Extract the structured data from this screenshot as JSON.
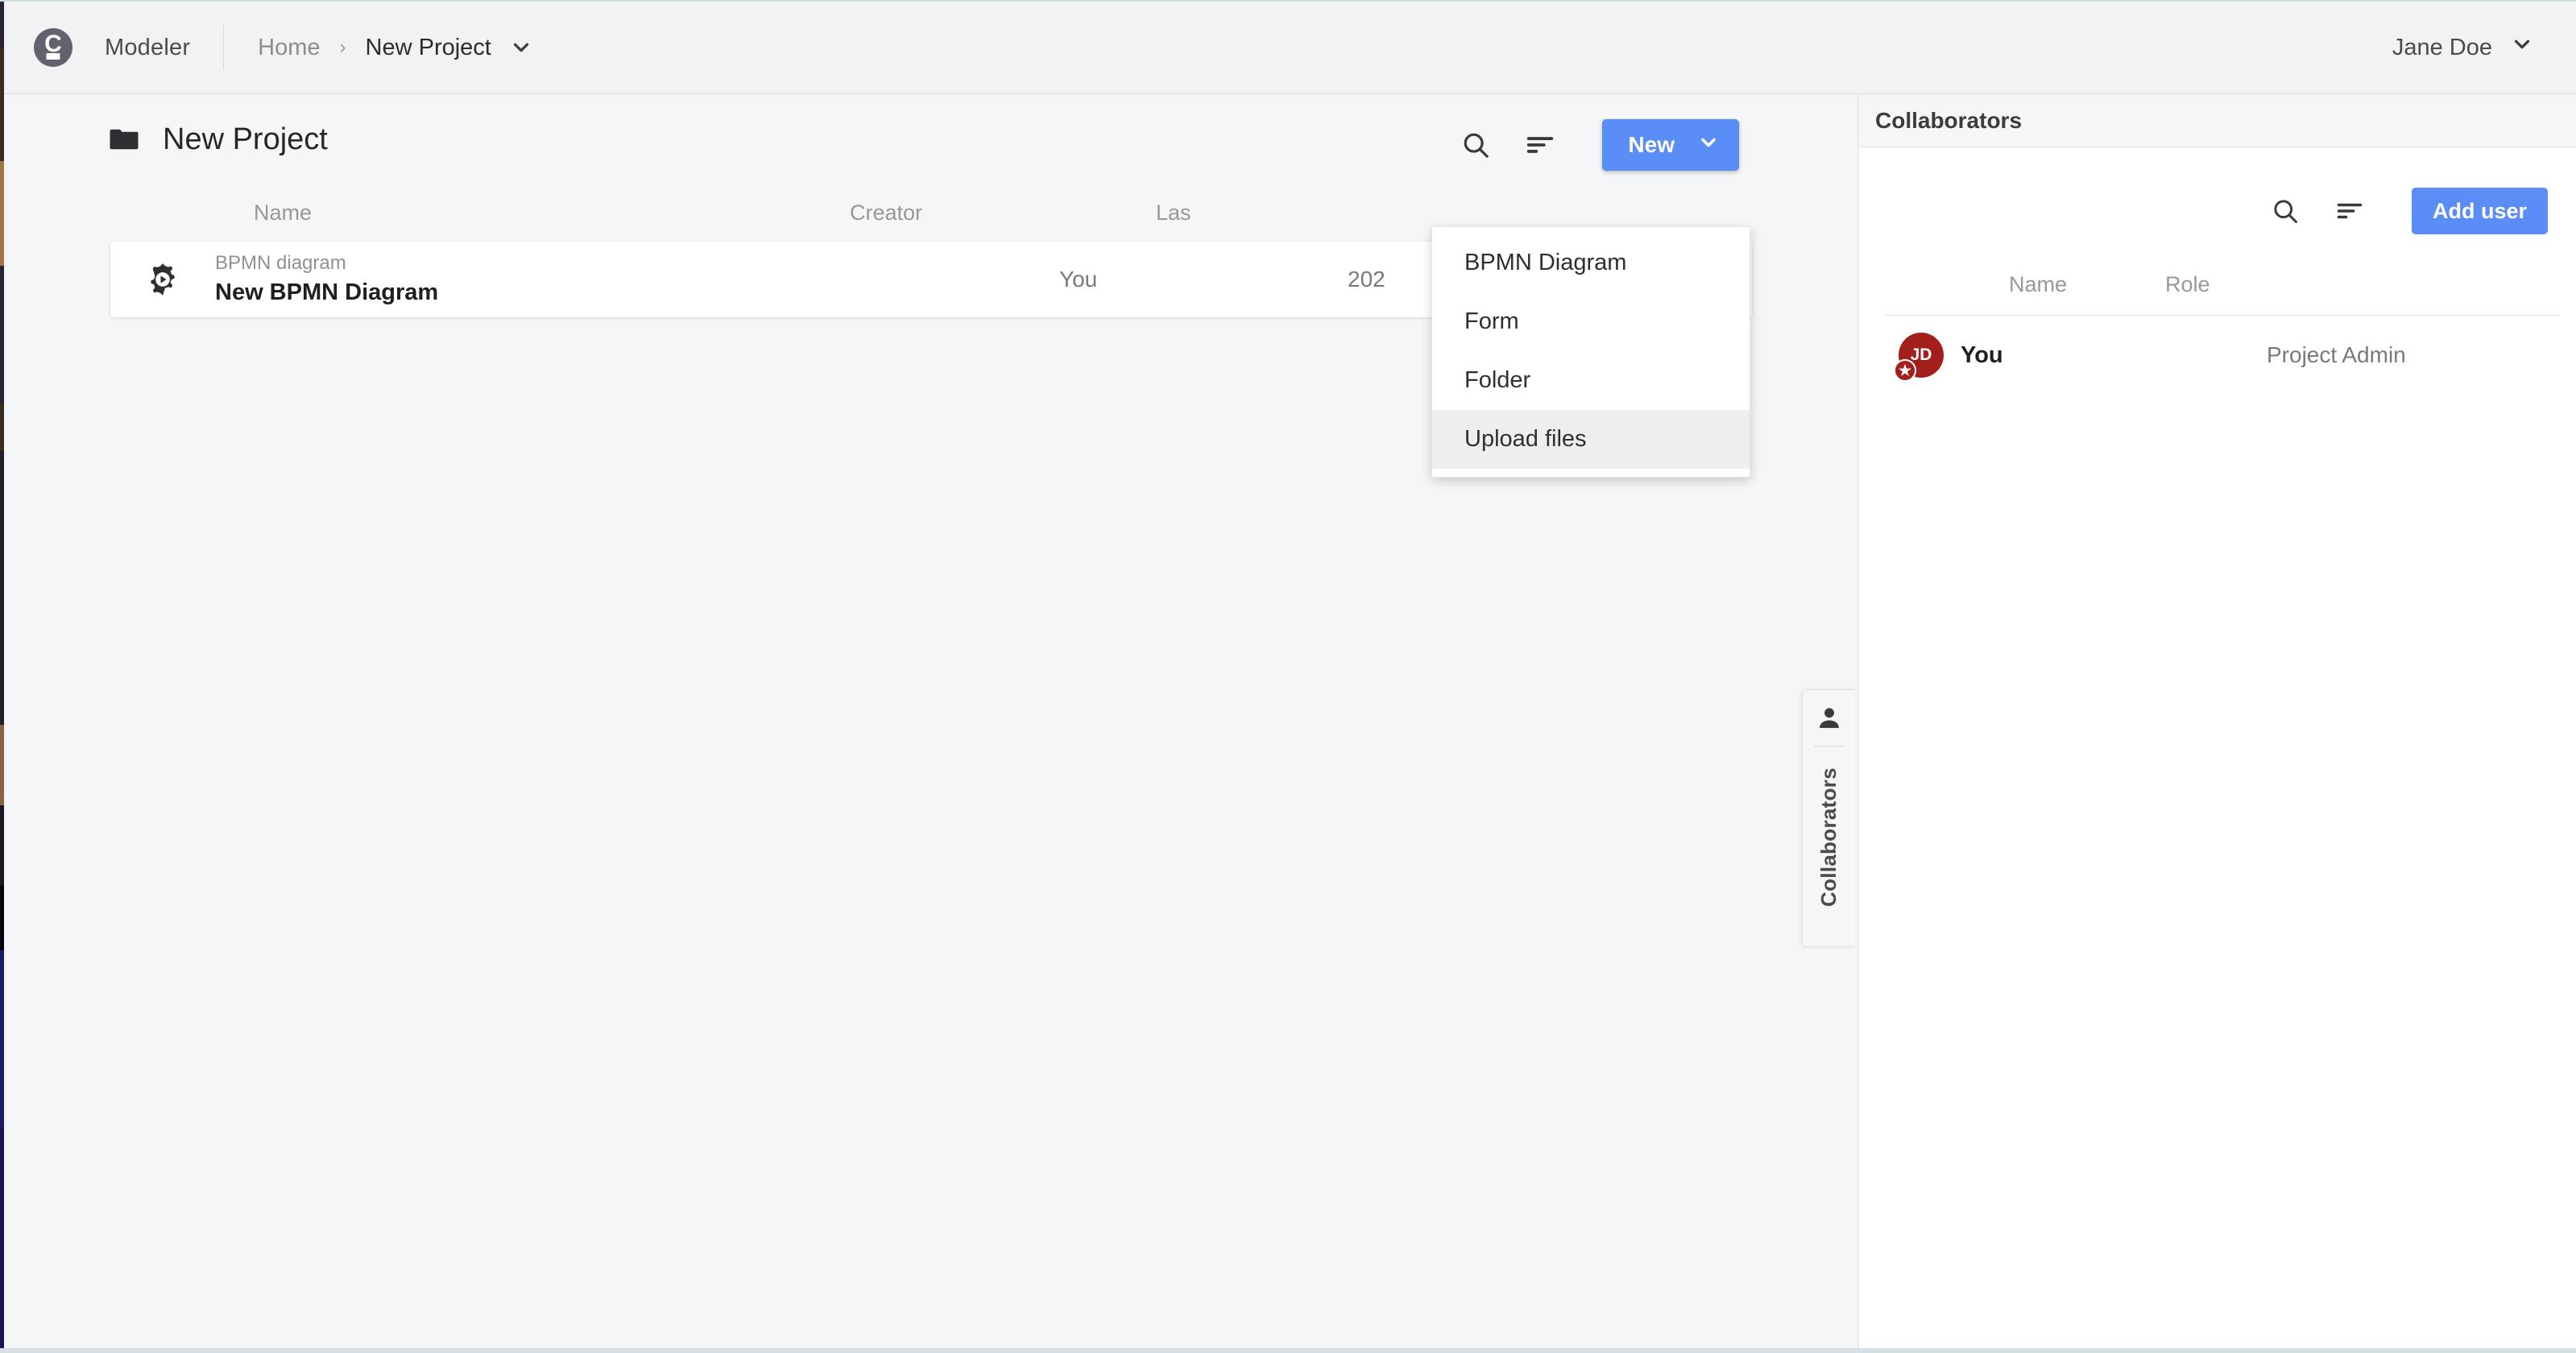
{
  "navbar": {
    "logo_icon": "camunda-logo-icon",
    "brand": "Modeler",
    "breadcrumb": {
      "home": "Home",
      "separator": "›",
      "current": "New Project",
      "caret_icon": "chevron-down-icon"
    },
    "user": {
      "name": "Jane Doe",
      "caret_icon": "chevron-down-icon"
    }
  },
  "main": {
    "folder_icon": "folder-icon",
    "project_title": "New Project",
    "actions": {
      "search_icon": "search-icon",
      "sort_icon": "sort-icon",
      "new_label": "New",
      "new_caret_icon": "chevron-down-icon"
    },
    "table": {
      "columns": [
        "Name",
        "Creator",
        "Las"
      ],
      "rows": [
        {
          "icon": "bpmn-diagram-icon",
          "type": "BPMN diagram",
          "name": "New BPMN Diagram",
          "creator": "You",
          "modified": "202"
        }
      ]
    }
  },
  "new_dropdown": {
    "items": [
      {
        "label": "BPMN Diagram",
        "active": false
      },
      {
        "label": "Form",
        "active": false
      },
      {
        "label": "Folder",
        "active": false
      },
      {
        "label": "Upload files",
        "active": true
      }
    ]
  },
  "collaborators_tab": {
    "icon": "person-icon",
    "label": "Collaborators"
  },
  "collaborators_panel": {
    "title": "Collaborators",
    "actions": {
      "search_icon": "search-icon",
      "sort_icon": "sort-icon",
      "add_user_label": "Add user"
    },
    "columns": [
      "Name",
      "Role"
    ],
    "rows": [
      {
        "avatar_initials": "JD",
        "avatar_badge_icon": "star-icon",
        "name": "You",
        "role": "Project Admin"
      }
    ]
  },
  "colors": {
    "accent_blue": "#5a8df6",
    "avatar_red": "#a21f1c",
    "logo_gray": "#62626f",
    "page_bg": "#f5f6f7"
  }
}
